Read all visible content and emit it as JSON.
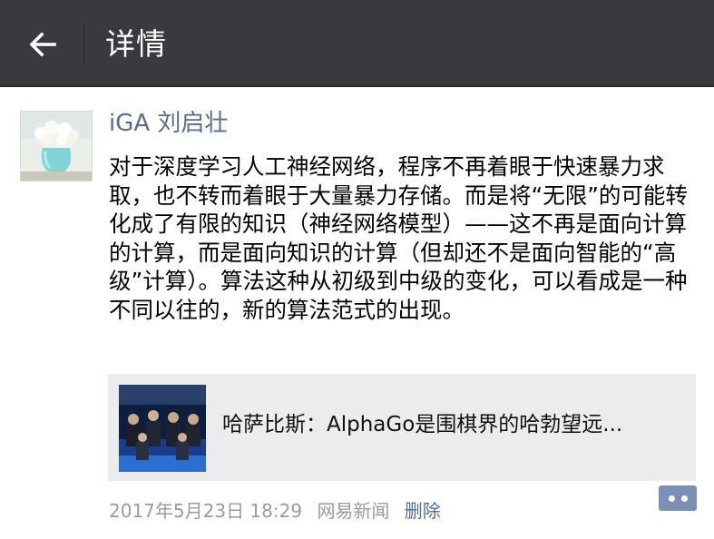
{
  "header": {
    "title": "详情",
    "back_icon": "arrow-left-icon",
    "background": "#393a3f"
  },
  "post": {
    "author": "iGA 刘启壮",
    "text": "对于深度学习人工神经网络，程序不再着眼于快速暴力求取，也不转而着眼于大量暴力存储。而是将“无限”的可能转化成了有限的知识（神经网络模型）——这不再是面向计算的计算，而是面向知识的计算（但却还不是面向智能的“高级”计算）。算法这种从初级到中级的变化，可以看成是一种不同以往的，新的算法范式的出现。",
    "link": {
      "title": "哈萨比斯：AlphaGo是围棋界的哈勃望远..."
    },
    "timestamp": "2017年5月23日 18:29",
    "source": "网易新闻",
    "delete_label": "删除",
    "comment_icon": "comment-more-icon"
  },
  "colors": {
    "nickname": "#576b95",
    "meta": "#9b9b9b",
    "card_bg": "#ececec"
  }
}
